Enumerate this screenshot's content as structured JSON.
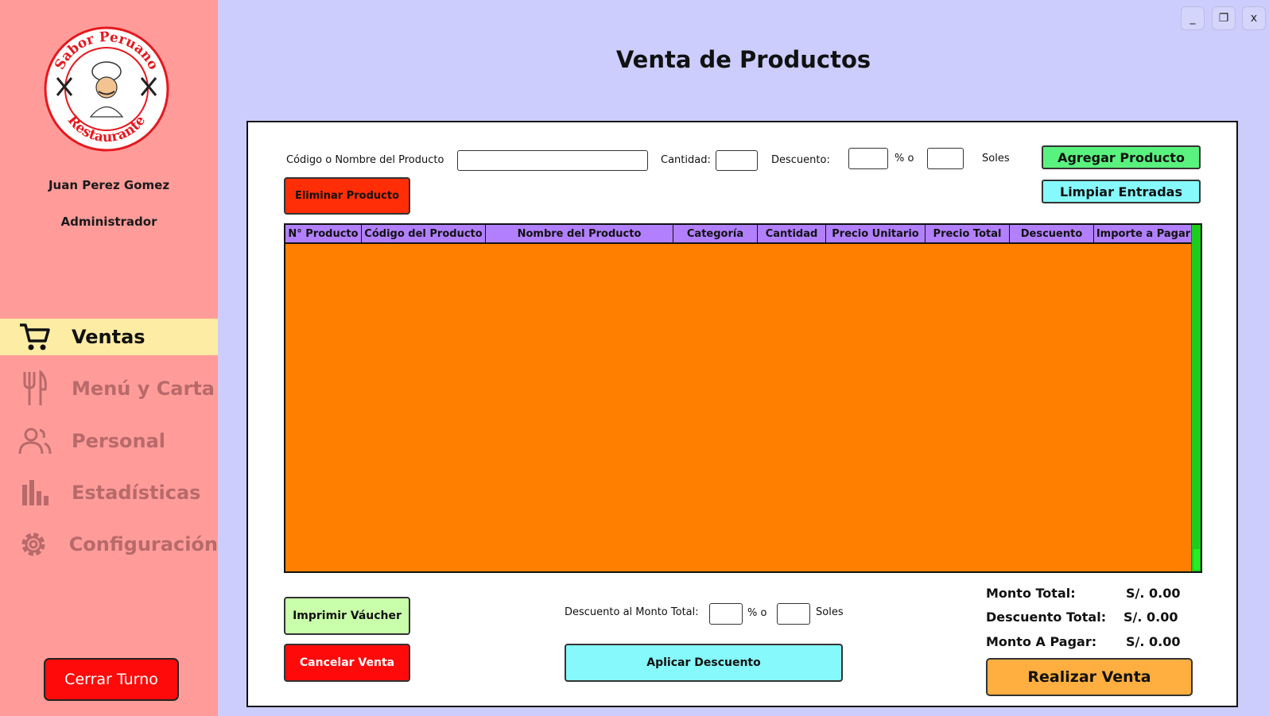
{
  "sidebar": {
    "logo_text_top": "Sabor Peruano",
    "logo_text_bottom": "Restaurante",
    "user_name": "Juan Perez Gomez",
    "user_role": "Administrador",
    "items": [
      {
        "label": "Ventas",
        "icon": "cart-icon",
        "active": true
      },
      {
        "label": "Menú y Carta",
        "icon": "fork-knife-icon",
        "active": false
      },
      {
        "label": "Personal",
        "icon": "users-icon",
        "active": false
      },
      {
        "label": "Estadísticas",
        "icon": "bar-chart-icon",
        "active": false
      },
      {
        "label": "Configuración",
        "icon": "gear-icon",
        "active": false
      }
    ],
    "logout_label": "Cerrar Turno"
  },
  "window_controls": {
    "minimize": "_",
    "maximize": "❐",
    "close": "x"
  },
  "page_title": "Venta de Productos",
  "form": {
    "product_label": "Código o Nombre del Producto",
    "product_value": "",
    "quantity_label": "Cantidad:",
    "quantity_value": "",
    "discount_label": "Descuento:",
    "discount_percent_value": "",
    "percent_or": "% o",
    "discount_soles_value": "",
    "soles_label": "Soles",
    "add_button": "Agregar Producto",
    "remove_button": "Eliminar Producto",
    "clear_button": "Limpiar Entradas"
  },
  "table": {
    "columns": [
      "N° Producto",
      "Código del Producto",
      "Nombre del Producto",
      "Categoría",
      "Cantidad",
      "Precio Unitario",
      "Precio Total",
      "Descuento",
      "Importe a Pagar"
    ],
    "rows": []
  },
  "footer": {
    "print_button": "Imprimir Váucher",
    "cancel_button": "Cancelar Venta",
    "total_discount_label": "Descuento al Monto Total:",
    "total_discount_percent_value": "",
    "percent_or": "% o",
    "total_discount_soles_value": "",
    "soles_label": "Soles",
    "apply_button": "Aplicar Descuento",
    "monto_total_label": "Monto Total:",
    "monto_total_value": "S/. 0.00",
    "descuento_total_label": "Descuento Total:",
    "descuento_total_value": "S/. 0.00",
    "monto_pagar_label": "Monto A Pagar:",
    "monto_pagar_value": "S/. 0.00",
    "sell_button": "Realizar Venta"
  },
  "colors": {
    "sidebar": "#ff9c9a",
    "active_nav": "#fdeca3",
    "background": "#cccdfd",
    "table_body": "#ff8000",
    "table_header": "#b280ff",
    "add_button": "#59f27e",
    "clear_button": "#86f9fd",
    "remove_button": "#ff2e06",
    "print_button": "#c9ffaa",
    "cancel_button": "#ff0a0a",
    "apply_button": "#86f9fd",
    "sell_button": "#ffaf40",
    "logout_button": "#ff0a0a"
  }
}
